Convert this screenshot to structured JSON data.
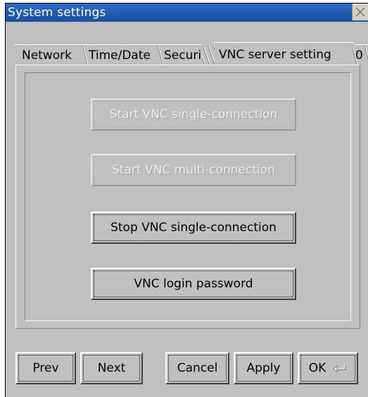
{
  "window": {
    "title": "System settings"
  },
  "tabs": [
    {
      "label": "Network"
    },
    {
      "label": "Time/Date"
    },
    {
      "label": "Securi"
    },
    {
      "label": "VNC server setting",
      "active": true
    },
    {
      "label": "0"
    }
  ],
  "actions": {
    "start_single": {
      "label": "Start VNC single-connection",
      "enabled": false
    },
    "start_multi": {
      "label": "Start VNC multi-connection",
      "enabled": false
    },
    "stop_single": {
      "label": "Stop VNC single-connection",
      "enabled": true
    },
    "login_password": {
      "label": "VNC login password",
      "enabled": true
    }
  },
  "footer": {
    "prev": "Prev",
    "next": "Next",
    "cancel": "Cancel",
    "apply": "Apply",
    "ok": "OK"
  },
  "icons": {
    "close": "close-icon",
    "enter": "enter-icon"
  },
  "colors": {
    "titlebar": "#1f5aa8",
    "window_bg": "#c0c0c0"
  }
}
